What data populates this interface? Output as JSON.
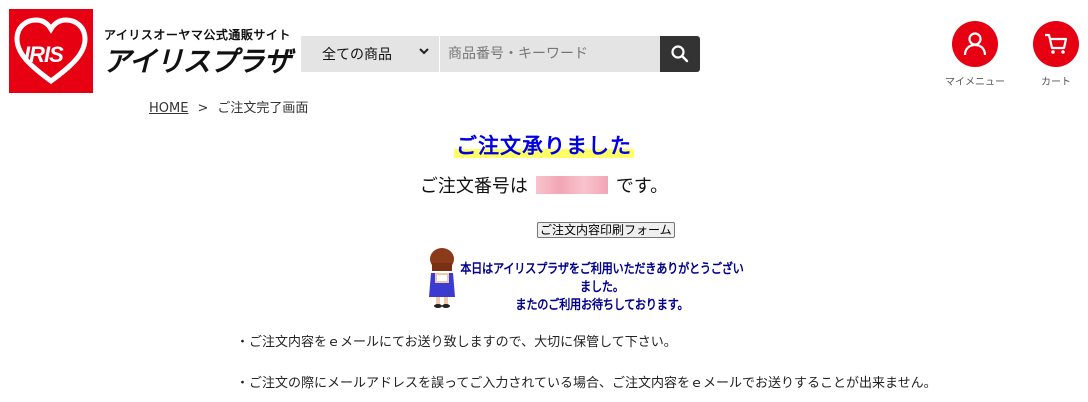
{
  "header": {
    "logo_text": "IRIS",
    "brand_sub": "アイリスオーヤマ公式通販サイト",
    "brand_main": "アイリスプラザ",
    "search": {
      "category": "全ての商品",
      "placeholder": "商品番号・キーワード"
    },
    "my_menu_label": "マイメニュー",
    "cart_label": "カート"
  },
  "breadcrumb": {
    "home": "HOME",
    "separator": ">",
    "current": "ご注文完了画面"
  },
  "main": {
    "title": "ご注文承りました",
    "order_prefix": "ご注文番号は",
    "order_suffix": "です。",
    "print_button": "ご注文内容印刷フォーム",
    "thanks_line1": "本日はアイリスプラザをご利用いただきありがとうございました。",
    "thanks_line2": "またのご利用お待ちしております。",
    "notes": [
      "・ご注文内容をｅメールにてお送り致しますので、大切に保管して下さい。",
      "・ご注文の際にメールアドレスを誤ってご入力されている場合、ご注文内容をｅメールでお送りすることが出来ません。"
    ]
  },
  "colors": {
    "brand_red": "#e60012",
    "title_blue": "#0000e0",
    "highlight": "#ffff66"
  }
}
